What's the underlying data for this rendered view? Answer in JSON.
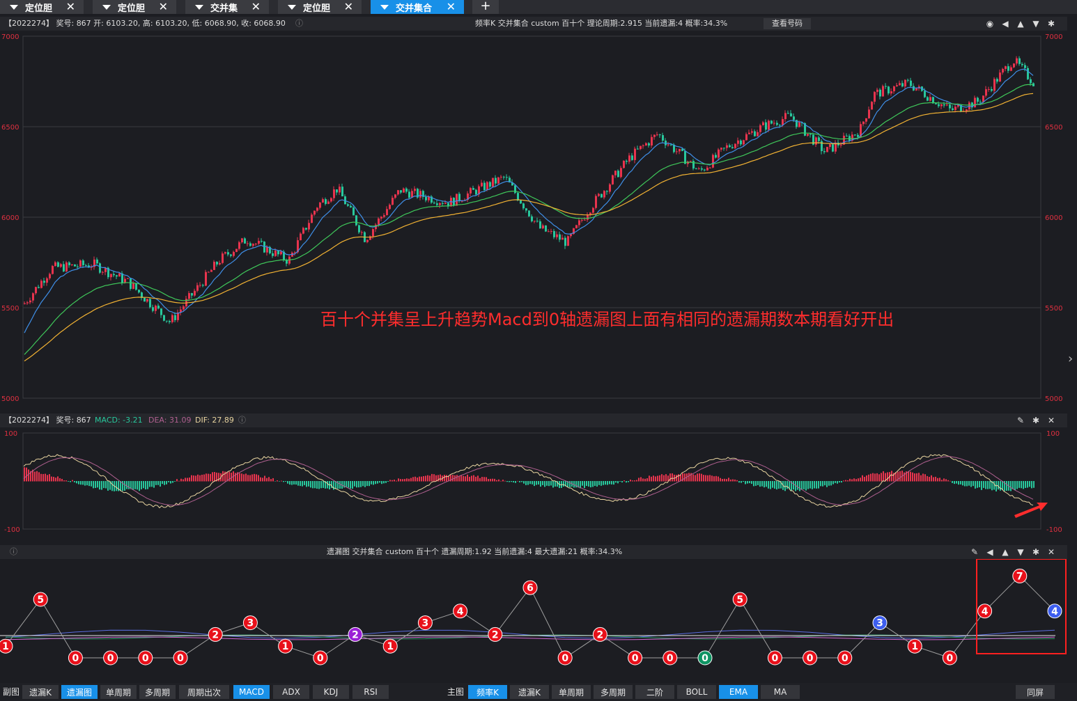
{
  "tabs": [
    {
      "label": "定位胆",
      "active": false
    },
    {
      "label": "定位胆",
      "active": false
    },
    {
      "label": "交并集",
      "active": false
    },
    {
      "label": "定位胆",
      "active": false
    },
    {
      "label": "交并集合",
      "active": true
    }
  ],
  "add_tab_label": "+",
  "main_info": {
    "left": "【2022274】 奖号: 867  开: 6103.20, 高: 6103.20, 低: 6068.90, 收: 6068.90",
    "right": "频率K   交并集合   custom   百十个   理论周期:2.915   当前遗漏:4   概率:34.3%",
    "button": "查看号码"
  },
  "main_chart": {
    "y_ticks": [
      "7000",
      "6500",
      "6000",
      "5500",
      "5000"
    ],
    "annotation": "百十个并集呈上升趋势Macd到0轴遗漏图上面有相同的遗漏期数本期看好开出",
    "colors": {
      "up": "#e8344e",
      "down": "#28c79c",
      "ma_fast": "#3f8fe8",
      "ma_mid": "#3fc85a",
      "ma_slow": "#f2b233",
      "annotation": "#ff2d2d"
    }
  },
  "macd_info": {
    "prefix": "【2022274】 奖号: 867",
    "macd": "MACD: -3.21",
    "dea": "DEA: 31.09",
    "dif": "DIF: 27.89"
  },
  "macd_chart": {
    "y_ticks": [
      "100",
      "-100"
    ]
  },
  "miss_info": {
    "text": "遗漏图   交并集合   custom   百十个   遗漏周期:1.92   当前遗漏:4   最大遗漏:21   概率:34.3%"
  },
  "miss_chart": {
    "chart_data": {
      "type": "line",
      "series": [
        {
          "values": [
            1,
            5,
            0,
            0,
            0,
            0,
            2,
            3,
            1,
            0,
            2,
            1,
            3,
            4,
            2,
            6,
            0,
            2,
            0,
            0,
            0,
            5,
            0,
            0,
            0,
            3,
            1,
            0,
            4,
            7,
            4
          ]
        }
      ],
      "marker_colors": [
        "red",
        "red",
        "red",
        "red",
        "red",
        "red",
        "red",
        "red",
        "red",
        "red",
        "purple",
        "red",
        "red",
        "red",
        "red",
        "red",
        "red",
        "red",
        "red",
        "red",
        "green",
        "red",
        "red",
        "red",
        "red",
        "blue",
        "red",
        "red",
        "red",
        "red",
        "blue"
      ]
    }
  },
  "bottom_bar": {
    "sub_label": "副图",
    "sub_buttons": [
      {
        "label": "遗漏K",
        "sel": false
      },
      {
        "label": "遗漏图",
        "sel": true
      },
      {
        "label": "单周期",
        "sel": false
      },
      {
        "label": "多周期",
        "sel": false
      },
      {
        "label": "周期出次",
        "sel": false
      },
      {
        "label": "MACD",
        "sel": true
      },
      {
        "label": "ADX",
        "sel": false
      },
      {
        "label": "KDJ",
        "sel": false
      },
      {
        "label": "RSI",
        "sel": false
      }
    ],
    "main_label": "主图",
    "main_buttons": [
      {
        "label": "频率K",
        "sel": true
      },
      {
        "label": "遗漏K",
        "sel": false
      },
      {
        "label": "单周期",
        "sel": false
      },
      {
        "label": "多周期",
        "sel": false
      },
      {
        "label": "二阶",
        "sel": false
      },
      {
        "label": "BOLL",
        "sel": false
      },
      {
        "label": "EMA",
        "sel": true
      },
      {
        "label": "MA",
        "sel": false
      }
    ],
    "split_label": "同屏"
  }
}
